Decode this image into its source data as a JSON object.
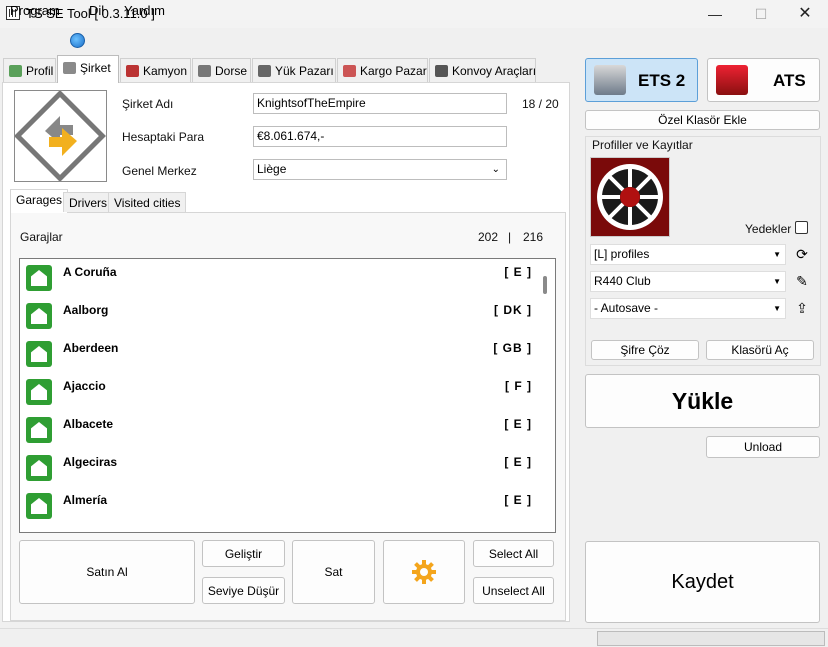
{
  "window": {
    "title": "TS SE Tool [ 0.3.11.0 ]",
    "minimize": "—",
    "maximize": "☐",
    "close": "✕"
  },
  "menu": {
    "items": [
      "Program",
      "Dil",
      "Yardım"
    ]
  },
  "tabs": [
    "Profil",
    "Şirket",
    "Kamyon",
    "Dorse",
    "Yük Pazarı",
    "Kargo Pazarı",
    "Konvoy Araçları"
  ],
  "company": {
    "name_label": "Şirket Adı",
    "name_value": "KnightsofTheEmpire",
    "name_count": "18 / 20",
    "money_label": "Hesaptaki Para",
    "money_value": "€8.061.674,-",
    "hq_label": "Genel Merkez",
    "hq_value": "Liège"
  },
  "subtabs": [
    "Garages",
    "Drivers",
    "Visited cities"
  ],
  "garages": {
    "heading": "Garajlar",
    "count_owned": "202",
    "separator": "|",
    "count_total": "216",
    "rows": [
      {
        "city": "A Coruña",
        "code": "[ E ]"
      },
      {
        "city": "Aalborg",
        "code": "[ DK ]"
      },
      {
        "city": "Aberdeen",
        "code": "[ GB ]"
      },
      {
        "city": "Ajaccio",
        "code": "[ F ]"
      },
      {
        "city": "Albacete",
        "code": "[ E ]"
      },
      {
        "city": "Algeciras",
        "code": "[ E ]"
      },
      {
        "city": "Almería",
        "code": "[ E ]"
      }
    ]
  },
  "buttons": {
    "buy": "Satın Al",
    "upgrade": "Geliştir",
    "downgrade": "Seviye Düşür",
    "sell": "Sat",
    "select_all": "Select All",
    "unselect_all": "Unselect All",
    "custom_folder": "Özel Klasör Ekle",
    "decrypt": "Şifre Çöz",
    "open_folder": "Klasörü Aç",
    "load": "Yükle",
    "unload": "Unload",
    "save": "Kaydet"
  },
  "games": {
    "ets": "ETS 2",
    "ats": "ATS"
  },
  "profiles": {
    "group_label": "Profiller ve Kayıtlar",
    "backups_label": "Yedekler",
    "folder": "[L] profiles",
    "profile": "R440 Club",
    "save": "- Autosave -"
  }
}
